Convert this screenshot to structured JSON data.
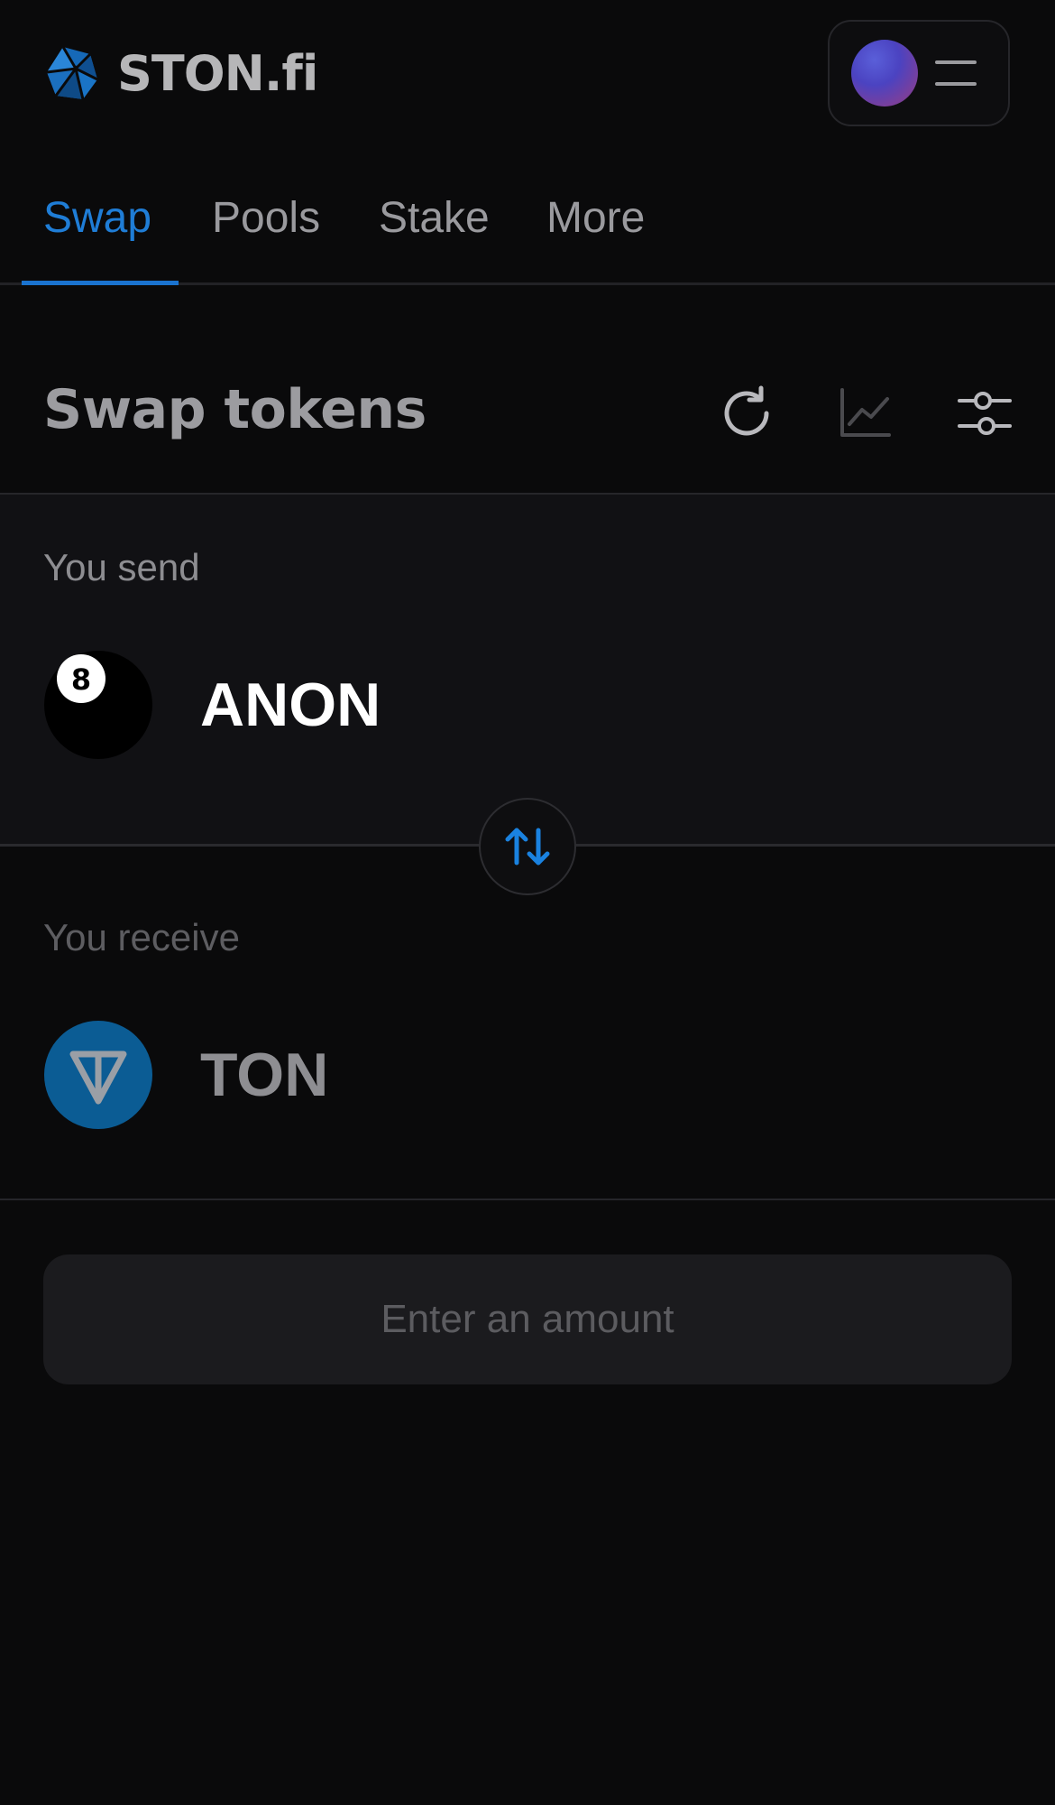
{
  "header": {
    "logo_text": "STON.fi",
    "logo_icon": "ston-logo-icon",
    "wallet_avatar": "avatar",
    "menu_icon": "menu-icon"
  },
  "tabs": [
    {
      "label": "Swap",
      "active": true
    },
    {
      "label": "Pools",
      "active": false
    },
    {
      "label": "Stake",
      "active": false
    },
    {
      "label": "More",
      "active": false
    }
  ],
  "swap": {
    "title": "Swap tokens",
    "actions": [
      "refresh-icon",
      "chart-icon",
      "settings-sliders-icon"
    ],
    "send": {
      "label": "You send",
      "token_symbol": "ANON",
      "token_icon": "eight-ball-icon"
    },
    "switch_icon": "swap-arrows-icon",
    "receive": {
      "label": "You receive",
      "token_symbol": "TON",
      "token_icon": "ton-icon"
    },
    "cta_label": "Enter an amount"
  },
  "colors": {
    "background": "#0a0a0b",
    "accent": "#1f7dd6",
    "ton_blue": "#0b5c94"
  }
}
